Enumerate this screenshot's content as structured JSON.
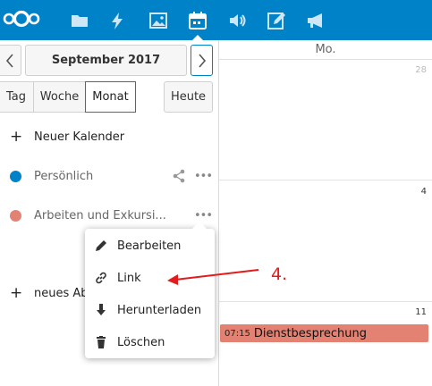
{
  "header": {
    "nav_icons": [
      "files-icon",
      "activity-icon",
      "gallery-icon",
      "calendar-icon",
      "audio-icon",
      "notes-icon",
      "announcement-icon"
    ],
    "accent": "#0082c9"
  },
  "sidebar": {
    "month_label": "September 2017",
    "views": [
      "Tag",
      "Woche",
      "Monat"
    ],
    "active_view": "Monat",
    "today_label": "Heute",
    "new_calendar_label": "Neuer Kalender",
    "calendars": [
      {
        "name": "Persönlich",
        "color": "#0082c9"
      },
      {
        "name": "Arbeiten und Exkursi...",
        "color": "#e38272"
      }
    ],
    "new_subscription_label": "neues Abo"
  },
  "menu": {
    "items": [
      {
        "label": "Bearbeiten",
        "icon": "pencil-icon"
      },
      {
        "label": "Link",
        "icon": "link-icon"
      },
      {
        "label": "Herunterladen",
        "icon": "download-icon"
      },
      {
        "label": "Löschen",
        "icon": "trash-icon"
      }
    ]
  },
  "calendar": {
    "day_header": "Mo.",
    "days": [
      "28",
      "4",
      "11"
    ],
    "event": {
      "time": "07:15",
      "title": "Dienstbesprechung",
      "color": "#e38272"
    }
  },
  "annotation": {
    "label": "4."
  }
}
